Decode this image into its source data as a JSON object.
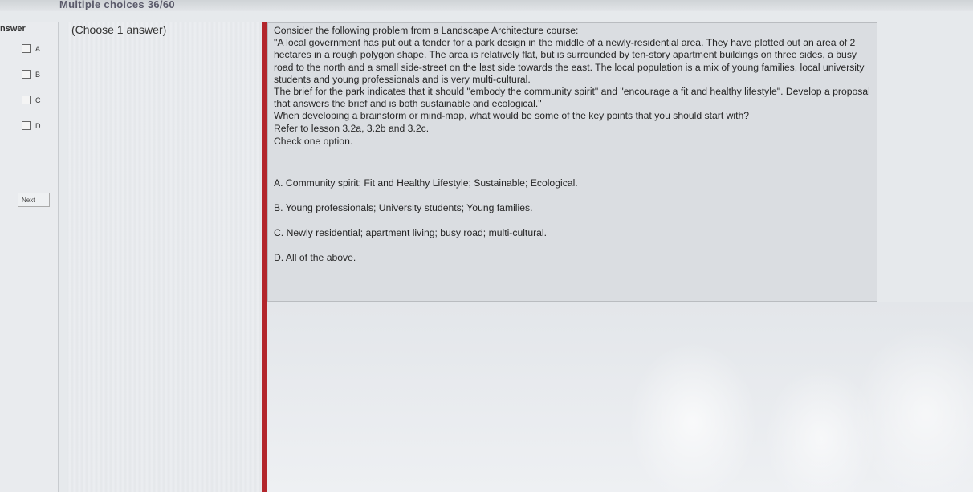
{
  "header": {
    "section_title": "Multiple choices 36/60"
  },
  "answer_panel": {
    "header": "nswer",
    "options": [
      "A",
      "B",
      "C",
      "D"
    ],
    "next_label": "Next"
  },
  "choose": {
    "instruction": "(Choose 1 answer)"
  },
  "question": {
    "lines": [
      "Consider the following problem from a Landscape Architecture course:",
      "\"A local government has put out a tender for a park design in the middle of a newly-residential area. They have plotted out an area of 2 hectares in a rough polygon shape. The area is relatively flat, but is surrounded by ten-story apartment buildings on three sides, a busy road to the north and a small side-street on the last side towards the east. The local population is a mix of young families, local university students and young professionals and is very multi-cultural.",
      "The brief for the park indicates that it should \"embody the community spirit\" and \"encourage a fit and healthy lifestyle\". Develop a proposal that answers the brief and is both sustainable and ecological.\"",
      "When developing a brainstorm or mind-map, what would be some of the key points that you should start with?",
      "Refer to lesson 3.2a, 3.2b and 3.2c."
    ],
    "check": "Check one option."
  },
  "answers": [
    "A. Community spirit; Fit and Healthy Lifestyle; Sustainable; Ecological.",
    "B. Young professionals; University students; Young families.",
    "C. Newly residential; apartment living; busy road; multi-cultural.",
    "D. All of the above."
  ],
  "colors": {
    "accent_bar": "#b3262c",
    "panel_bg": "#dadde1"
  }
}
